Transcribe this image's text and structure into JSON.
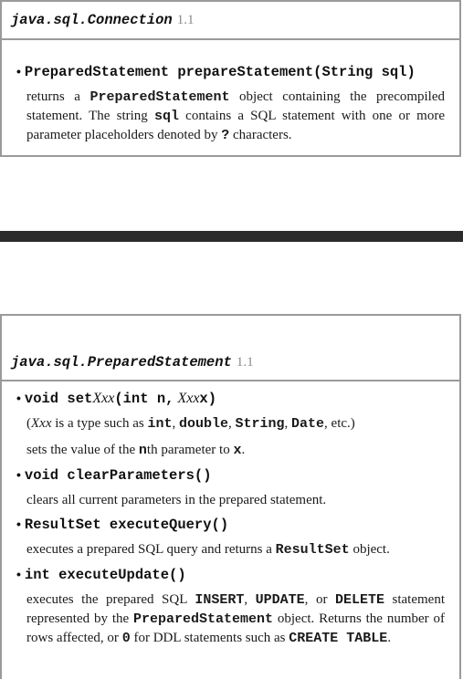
{
  "box1": {
    "class_name": "java.sql.Connection",
    "version": "1.1",
    "method": {
      "signature": "PreparedStatement prepareStatement(String sql)",
      "desc": {
        "p1": "returns a ",
        "c1": "PreparedStatement",
        "p2": " object containing the precompiled statement. The string ",
        "c2": "sql",
        "p3": " contains a SQL statement with one or more parameter placeholders denoted by ",
        "c3": "?",
        "p4": " characters."
      }
    }
  },
  "box2": {
    "class_name": "java.sql.PreparedStatement",
    "version": "1.1",
    "methods": [
      {
        "sig_a": "void set",
        "sig_b": "Xxx",
        "sig_c": "(int n, ",
        "sig_d": "Xxx",
        "sig_e": " x)",
        "note": {
          "n1": "Xxx",
          "n2": " is a type such as ",
          "t1": "int",
          "s1": ", ",
          "t2": "double",
          "s2": ", ",
          "t3": "String",
          "s3": ", ",
          "t4": "Date",
          "s4": ", etc.)"
        },
        "desc": {
          "p1": "sets the value of the ",
          "c1": "n",
          "p2": "th parameter to ",
          "c2": "x",
          "p3": "."
        }
      },
      {
        "signature": "void clearParameters()",
        "desc": "clears all current parameters in the prepared statement."
      },
      {
        "signature": "ResultSet executeQuery()",
        "desc": {
          "p1": "executes a prepared SQL query and returns a ",
          "c1": "ResultSet",
          "p2": " object."
        }
      },
      {
        "signature": "int executeUpdate()",
        "desc": {
          "p1": "executes the prepared SQL ",
          "c1": "INSERT",
          "p2": ", ",
          "c2": "UPDATE",
          "p3": ", or ",
          "c3": "DELETE",
          "p4": " statement represented by the ",
          "c4": "PreparedStatement",
          "p5": " object. Returns the number of rows affected, or ",
          "c5": "0",
          "p6": " for DDL statements such as ",
          "c6": "CREATE TABLE",
          "p7": "."
        }
      }
    ]
  }
}
